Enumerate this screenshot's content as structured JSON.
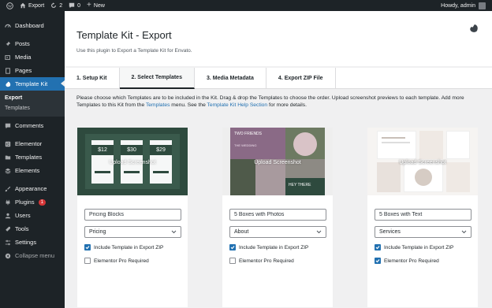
{
  "admin_bar": {
    "site_name": "Export",
    "updates_count": "2",
    "comments_count": "0",
    "new_label": "New",
    "howdy": "Howdy, admin"
  },
  "sidebar": {
    "items": [
      {
        "label": "Dashboard",
        "icon": "dashboard-icon"
      },
      {
        "label": "Posts",
        "icon": "pin-icon"
      },
      {
        "label": "Media",
        "icon": "media-icon"
      },
      {
        "label": "Pages",
        "icon": "pages-icon"
      },
      {
        "label": "Template Kit",
        "icon": "template-kit-icon"
      }
    ],
    "submenu": [
      "Export",
      "Templates"
    ],
    "items2": [
      {
        "label": "Comments",
        "icon": "comment-icon"
      },
      {
        "label": "Elementor",
        "icon": "elementor-icon"
      },
      {
        "label": "Templates",
        "icon": "folder-icon"
      },
      {
        "label": "Elements",
        "icon": "elements-icon"
      },
      {
        "label": "Appearance",
        "icon": "brush-icon"
      },
      {
        "label": "Plugins",
        "icon": "plugin-icon",
        "badge": "1"
      },
      {
        "label": "Users",
        "icon": "users-icon"
      },
      {
        "label": "Tools",
        "icon": "wrench-icon"
      },
      {
        "label": "Settings",
        "icon": "settings-icon"
      },
      {
        "label": "Collapse menu",
        "icon": "collapse-icon"
      }
    ]
  },
  "header": {
    "title": "Template Kit - Export",
    "subtitle": "Use this plugin to Export a Template Kit for Envato."
  },
  "tabs": [
    "1. Setup Kit",
    "2. Select Templates",
    "3. Media Metadata",
    "4. Export ZIP File"
  ],
  "intro": {
    "p1": "Please choose which Templates are to be included in the Kit. Drag & drop the Templates to choose the order. Upload screenshot previews to each template. Add more Templates to this Kit from the ",
    "link1": "Templates",
    "p2": " menu. See the ",
    "link2": "Template Kit Help Section",
    "p3": " for more details."
  },
  "cards": [
    {
      "upload_label": "Upload Screenshot",
      "name": "Pricing Blocks",
      "type": "Pricing",
      "include_label": "Include Template in Export ZIP",
      "include_checked": true,
      "pro_label": "Elementor Pro Required",
      "pro_checked": false,
      "prices": [
        "$12",
        "$30",
        "$29"
      ]
    },
    {
      "upload_label": "Upload Screenshot",
      "name": "5 Boxes with Photos",
      "type": "About",
      "include_label": "Include Template in Export ZIP",
      "include_checked": true,
      "pro_label": "Elementor Pro Required",
      "pro_checked": false,
      "thumb_text": [
        "TWO FRIENDS",
        "THE WEDDING",
        "HEY THERE"
      ]
    },
    {
      "upload_label": "Upload Screenshot",
      "name": "5 Boxes with Text",
      "type": "Services",
      "include_label": "Include Template in Export ZIP",
      "include_checked": true,
      "pro_label": "Elementor Pro Required",
      "pro_checked": true
    }
  ],
  "colors": {
    "accent": "#2271b1",
    "admin_dark": "#1d2327",
    "pricing_green": "#2e4a3e"
  }
}
